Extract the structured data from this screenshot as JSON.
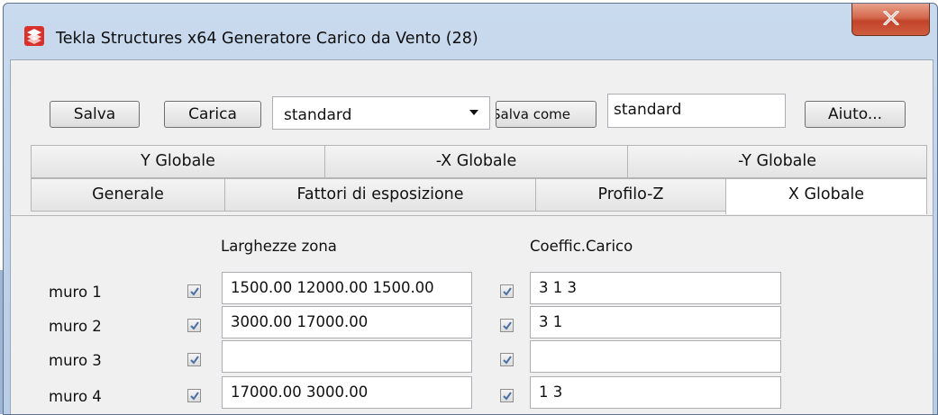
{
  "window": {
    "title": "Tekla Structures x64  Generatore Carico da Vento (28)",
    "close_label": "x"
  },
  "toolbar": {
    "save_label": "Salva",
    "load_label": "Carica",
    "preset_value": "standard",
    "save_as_label": "Salva come",
    "save_as_name": "standard",
    "help_label": "Aiuto..."
  },
  "tabs": {
    "row1": [
      {
        "label": "Y Globale"
      },
      {
        "label": "-X Globale"
      },
      {
        "label": "-Y Globale"
      }
    ],
    "row2": [
      {
        "label": "Generale"
      },
      {
        "label": "Fattori di esposizione"
      },
      {
        "label": "Profilo-Z"
      },
      {
        "label": "X Globale",
        "active": true
      }
    ]
  },
  "panel": {
    "header_zone": "Larghezze zona",
    "header_coeff": "Coeffic.Carico",
    "rows": [
      {
        "label": "muro 1",
        "zone_checked": true,
        "zone": "1500.00 12000.00 1500.00",
        "coeff_checked": true,
        "coeff": "3 1 3"
      },
      {
        "label": "muro 2",
        "zone_checked": true,
        "zone": "3000.00 17000.00",
        "coeff_checked": true,
        "coeff": "3 1"
      },
      {
        "label": "muro 3",
        "zone_checked": true,
        "zone": "",
        "coeff_checked": true,
        "coeff": ""
      },
      {
        "label": "muro 4",
        "zone_checked": true,
        "zone": "17000.00 3000.00",
        "coeff_checked": true,
        "coeff": "1 3"
      }
    ]
  },
  "colors": {
    "titlebar": "#b8cde6",
    "close_button": "#c2432a",
    "client_bg": "#f0f0f0",
    "checkmark": "#4a6fa5"
  }
}
